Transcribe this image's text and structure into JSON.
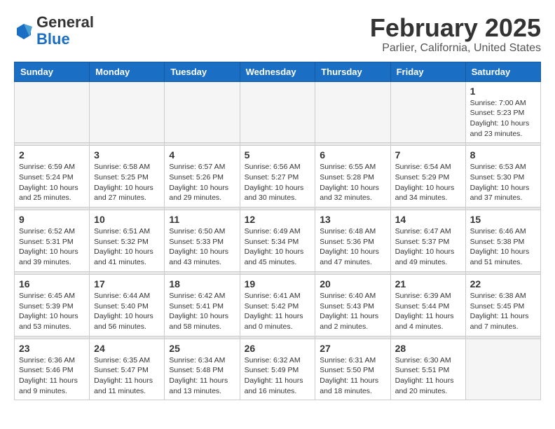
{
  "header": {
    "logo_general": "General",
    "logo_blue": "Blue",
    "month_title": "February 2025",
    "location": "Parlier, California, United States"
  },
  "weekdays": [
    "Sunday",
    "Monday",
    "Tuesday",
    "Wednesday",
    "Thursday",
    "Friday",
    "Saturday"
  ],
  "weeks": [
    [
      {
        "day": "",
        "info": ""
      },
      {
        "day": "",
        "info": ""
      },
      {
        "day": "",
        "info": ""
      },
      {
        "day": "",
        "info": ""
      },
      {
        "day": "",
        "info": ""
      },
      {
        "day": "",
        "info": ""
      },
      {
        "day": "1",
        "info": "Sunrise: 7:00 AM\nSunset: 5:23 PM\nDaylight: 10 hours\nand 23 minutes."
      }
    ],
    [
      {
        "day": "2",
        "info": "Sunrise: 6:59 AM\nSunset: 5:24 PM\nDaylight: 10 hours\nand 25 minutes."
      },
      {
        "day": "3",
        "info": "Sunrise: 6:58 AM\nSunset: 5:25 PM\nDaylight: 10 hours\nand 27 minutes."
      },
      {
        "day": "4",
        "info": "Sunrise: 6:57 AM\nSunset: 5:26 PM\nDaylight: 10 hours\nand 29 minutes."
      },
      {
        "day": "5",
        "info": "Sunrise: 6:56 AM\nSunset: 5:27 PM\nDaylight: 10 hours\nand 30 minutes."
      },
      {
        "day": "6",
        "info": "Sunrise: 6:55 AM\nSunset: 5:28 PM\nDaylight: 10 hours\nand 32 minutes."
      },
      {
        "day": "7",
        "info": "Sunrise: 6:54 AM\nSunset: 5:29 PM\nDaylight: 10 hours\nand 34 minutes."
      },
      {
        "day": "8",
        "info": "Sunrise: 6:53 AM\nSunset: 5:30 PM\nDaylight: 10 hours\nand 37 minutes."
      }
    ],
    [
      {
        "day": "9",
        "info": "Sunrise: 6:52 AM\nSunset: 5:31 PM\nDaylight: 10 hours\nand 39 minutes."
      },
      {
        "day": "10",
        "info": "Sunrise: 6:51 AM\nSunset: 5:32 PM\nDaylight: 10 hours\nand 41 minutes."
      },
      {
        "day": "11",
        "info": "Sunrise: 6:50 AM\nSunset: 5:33 PM\nDaylight: 10 hours\nand 43 minutes."
      },
      {
        "day": "12",
        "info": "Sunrise: 6:49 AM\nSunset: 5:34 PM\nDaylight: 10 hours\nand 45 minutes."
      },
      {
        "day": "13",
        "info": "Sunrise: 6:48 AM\nSunset: 5:36 PM\nDaylight: 10 hours\nand 47 minutes."
      },
      {
        "day": "14",
        "info": "Sunrise: 6:47 AM\nSunset: 5:37 PM\nDaylight: 10 hours\nand 49 minutes."
      },
      {
        "day": "15",
        "info": "Sunrise: 6:46 AM\nSunset: 5:38 PM\nDaylight: 10 hours\nand 51 minutes."
      }
    ],
    [
      {
        "day": "16",
        "info": "Sunrise: 6:45 AM\nSunset: 5:39 PM\nDaylight: 10 hours\nand 53 minutes."
      },
      {
        "day": "17",
        "info": "Sunrise: 6:44 AM\nSunset: 5:40 PM\nDaylight: 10 hours\nand 56 minutes."
      },
      {
        "day": "18",
        "info": "Sunrise: 6:42 AM\nSunset: 5:41 PM\nDaylight: 10 hours\nand 58 minutes."
      },
      {
        "day": "19",
        "info": "Sunrise: 6:41 AM\nSunset: 5:42 PM\nDaylight: 11 hours\nand 0 minutes."
      },
      {
        "day": "20",
        "info": "Sunrise: 6:40 AM\nSunset: 5:43 PM\nDaylight: 11 hours\nand 2 minutes."
      },
      {
        "day": "21",
        "info": "Sunrise: 6:39 AM\nSunset: 5:44 PM\nDaylight: 11 hours\nand 4 minutes."
      },
      {
        "day": "22",
        "info": "Sunrise: 6:38 AM\nSunset: 5:45 PM\nDaylight: 11 hours\nand 7 minutes."
      }
    ],
    [
      {
        "day": "23",
        "info": "Sunrise: 6:36 AM\nSunset: 5:46 PM\nDaylight: 11 hours\nand 9 minutes."
      },
      {
        "day": "24",
        "info": "Sunrise: 6:35 AM\nSunset: 5:47 PM\nDaylight: 11 hours\nand 11 minutes."
      },
      {
        "day": "25",
        "info": "Sunrise: 6:34 AM\nSunset: 5:48 PM\nDaylight: 11 hours\nand 13 minutes."
      },
      {
        "day": "26",
        "info": "Sunrise: 6:32 AM\nSunset: 5:49 PM\nDaylight: 11 hours\nand 16 minutes."
      },
      {
        "day": "27",
        "info": "Sunrise: 6:31 AM\nSunset: 5:50 PM\nDaylight: 11 hours\nand 18 minutes."
      },
      {
        "day": "28",
        "info": "Sunrise: 6:30 AM\nSunset: 5:51 PM\nDaylight: 11 hours\nand 20 minutes."
      },
      {
        "day": "",
        "info": ""
      }
    ]
  ]
}
